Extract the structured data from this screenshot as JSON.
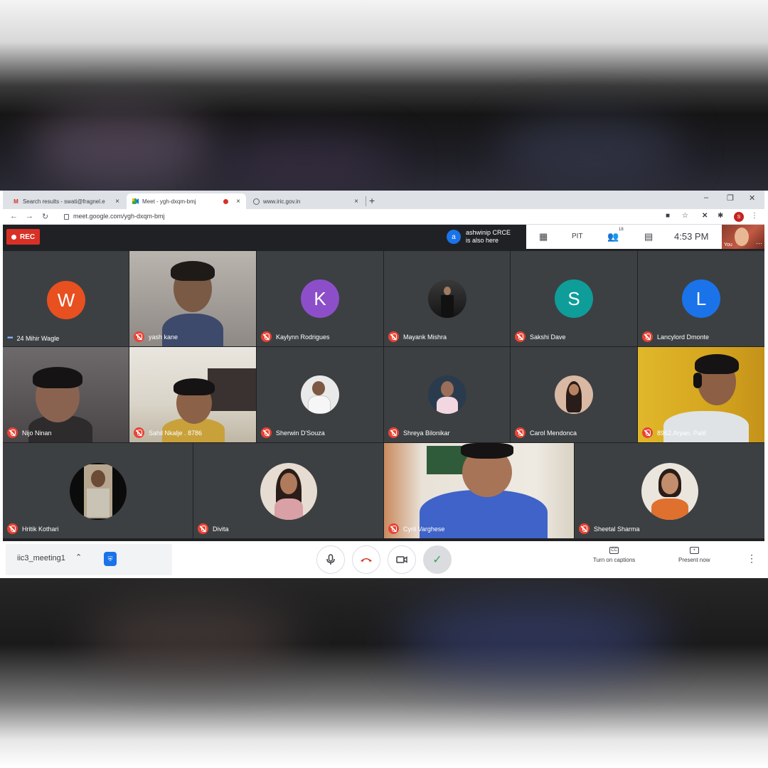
{
  "browser": {
    "tabs": [
      {
        "label": "Search results - swati@fragnel.e",
        "icon": "gmail-icon"
      },
      {
        "label": "Meet - ygh-dxqm-bmj",
        "icon": "meet-icon",
        "recording": true
      },
      {
        "label": "www.iric.gov.in",
        "icon": "globe-icon"
      }
    ],
    "url": "meet.google.com/ygh-dxqm-bmj",
    "profile_initial": "S"
  },
  "meet": {
    "rec_label": "REC",
    "notification": {
      "initial": "a",
      "line1": "ashwinip CRCE",
      "line2": "is also here"
    },
    "participant_count": "18",
    "time": "4:53 PM",
    "self_label": "You",
    "colors": {
      "W": "#e8501f",
      "K": "#8d4fc9",
      "S": "#0f9d9a",
      "L": "#1a73e8",
      "rec": "#d93025"
    },
    "participants": [
      {
        "name": "24 Mihir Wagle",
        "avatar": "W",
        "talking": true
      },
      {
        "name": "yash kane",
        "video": true
      },
      {
        "name": "Kaylynn Rodrigues",
        "avatar": "K"
      },
      {
        "name": "Mayank Mishra",
        "photo": true
      },
      {
        "name": "Sakshi Dave",
        "avatar": "S"
      },
      {
        "name": "Lancylord Dmonte",
        "avatar": "L"
      },
      {
        "name": "Nijo Ninan",
        "video": true
      },
      {
        "name": "Sahil Nkalje . 8786",
        "video": true
      },
      {
        "name": "Sherwin D'Souza",
        "photo": true
      },
      {
        "name": "Shreya Bilonikar",
        "photo": true
      },
      {
        "name": "Carol Mendonca",
        "photo": true
      },
      {
        "name": "8962.Aryan. Patil",
        "video": true
      },
      {
        "name": "Hritik Kothari",
        "photo": true
      },
      {
        "name": "Divita",
        "photo": true
      },
      {
        "name": "Cyril Varghese",
        "video": true
      },
      {
        "name": "Sheetal Sharma",
        "photo": true
      }
    ],
    "meeting_name": "iic3_meeting1",
    "captions_label": "Turn on captions",
    "present_label": "Present now"
  }
}
